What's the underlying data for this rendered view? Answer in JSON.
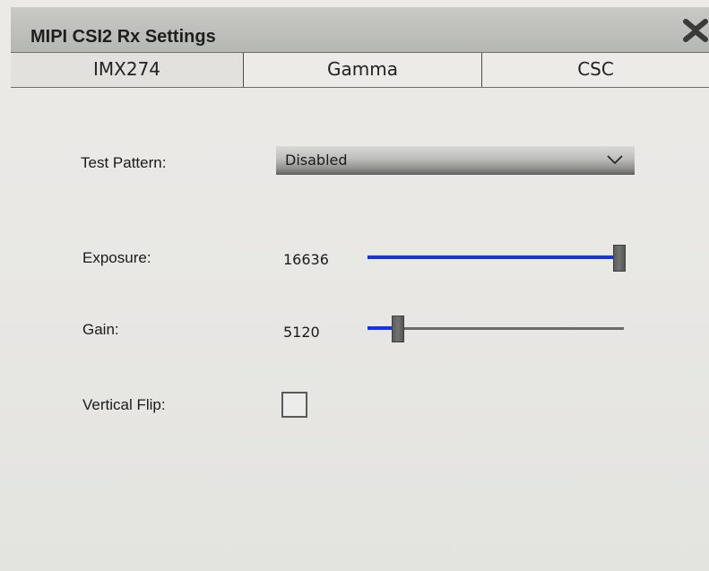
{
  "window": {
    "title": "MIPI CSI2 Rx Settings",
    "close_icon": "close-x-icon"
  },
  "tabs": [
    {
      "label": "IMX274",
      "active": true
    },
    {
      "label": "Gamma",
      "active": false
    },
    {
      "label": "CSC",
      "active": false
    }
  ],
  "settings": {
    "test_pattern": {
      "label": "Test Pattern:",
      "selected": "Disabled",
      "icon": "chevron-down-icon"
    },
    "exposure": {
      "label": "Exposure:",
      "value": "16636",
      "slider_fraction": 1.0
    },
    "gain": {
      "label": "Gain:",
      "value": "5120",
      "slider_fraction": 0.12
    },
    "vertical_flip": {
      "label": "Vertical Flip:",
      "checked": false
    }
  },
  "colors": {
    "slider_fill": "#1432f0",
    "slider_track": "#6a6a68"
  }
}
